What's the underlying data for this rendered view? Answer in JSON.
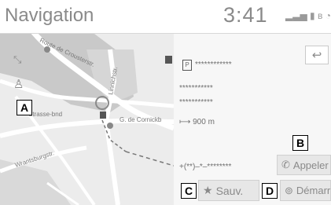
{
  "header": {
    "title": "Navigation",
    "clock": "3:41",
    "status_icons": [
      "signal-icon",
      "battery-icon",
      "bluetooth-icon",
      "wifi-icon"
    ]
  },
  "map": {
    "streets": [
      "Route de Crousterstr.",
      "Strasse-bnd",
      "Linnichstr.",
      "G. de Cornickb",
      "Wrantsburgstr."
    ],
    "icons": [
      "zoom-expand-icon",
      "pedestrian-icon",
      "position-marker-icon",
      "parking-icon"
    ]
  },
  "panel": {
    "name": "************",
    "address_line1": "***********",
    "address_line2": "***********",
    "distance": "900 m",
    "phone": "+(**)–*–********",
    "back_label": "↩"
  },
  "buttons": {
    "call": "Appeler",
    "save": "Sauv.",
    "start": "Démarre"
  },
  "callouts": {
    "a": "A",
    "b": "B",
    "c": "C",
    "d": "D"
  }
}
